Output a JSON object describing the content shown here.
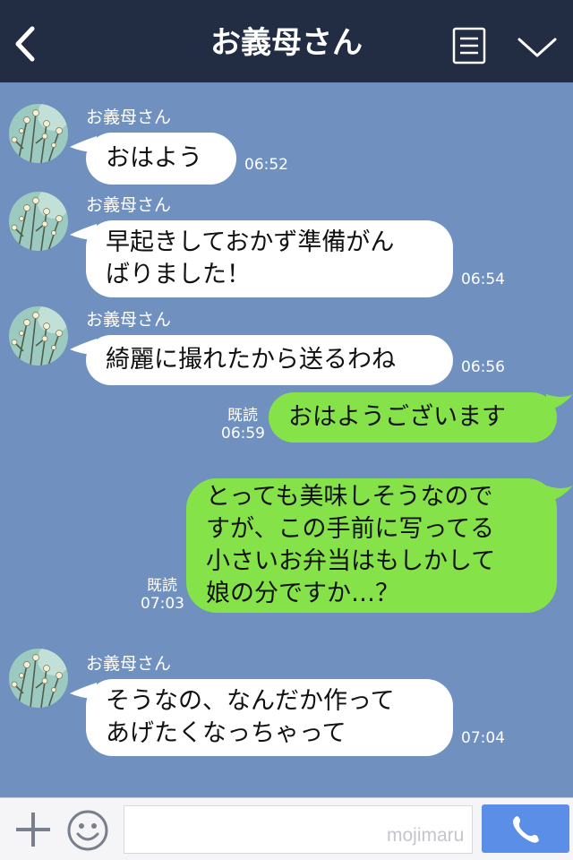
{
  "header": {
    "title": "お義母さん",
    "back_icon": "back-arrow-icon",
    "menu_icon": "menu-icon",
    "dropdown_icon": "chevron-down-icon",
    "background_color": "#222c43"
  },
  "chat": {
    "background_color": "#7091c0",
    "incoming_bubble_color": "#ffffff",
    "outgoing_bubble_color": "#85e249",
    "messages": [
      {
        "sender": "お義母さん",
        "text": "おはよう",
        "time": "06:52"
      },
      {
        "sender": "お義母さん",
        "text": "早起きしておかず準備がん\nばりました！",
        "time": "06:54"
      },
      {
        "sender": "お義母さん",
        "text": "綺麗に撮れたから送るわね",
        "time": "06:56"
      },
      {
        "status": "既読",
        "text": "おはようございます",
        "time": "06:59"
      },
      {
        "status": "既読",
        "text": "とっても美味しそうなので\nすが、この手前に写ってる\n小さいお弁当はもしかして\n娘の分ですか…？",
        "time": "07:03"
      },
      {
        "sender": "お義母さん",
        "text": "そうなの、なんだか作って\nあげたくなっちゃって",
        "time": "07:04"
      }
    ]
  },
  "input_bar": {
    "placeholder": "",
    "watermark": "mojimaru",
    "plus_icon": "plus-icon",
    "emoji_icon": "smiley-icon",
    "call_icon": "phone-icon",
    "call_button_color": "#5b8ee6"
  }
}
